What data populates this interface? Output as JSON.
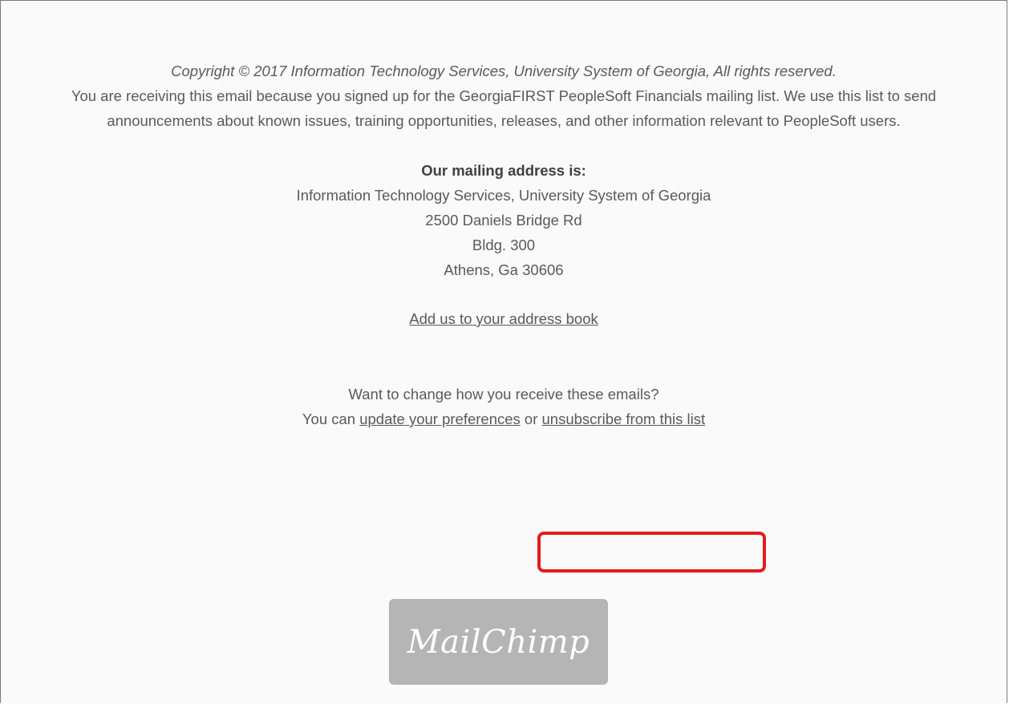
{
  "footer": {
    "copyright": "Copyright © 2017 Information Technology Services, University System of Georgia, All rights reserved.",
    "reason": "You are receiving this email because you signed up for the GeorgiaFIRST PeopleSoft Financials mailing list. We use this list to send announcements about known issues, training opportunities, releases, and other information relevant to PeopleSoft users.",
    "address_heading": "Our mailing address is:",
    "address_lines": [
      "Information Technology Services, University System of Georgia",
      "2500 Daniels Bridge Rd",
      "Bldg. 300",
      "Athens, Ga 30606"
    ],
    "add_address_book_link": "Add us to your address book",
    "change_question": "Want to change how you receive these emails?",
    "you_can": "You can",
    "update_prefs_link": "update your preferences",
    "or_text": "or",
    "unsubscribe_link": "unsubscribe from this list"
  },
  "badge": {
    "label": "MailChimp"
  },
  "colors": {
    "text": "#5a5a5a",
    "highlight": "#e31b1b",
    "badge_bg": "#b5b5b5"
  }
}
